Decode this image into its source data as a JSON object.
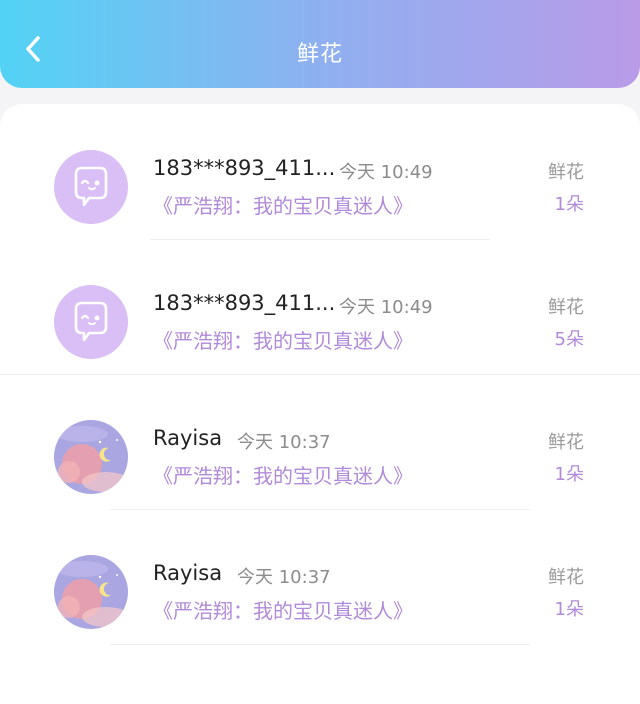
{
  "header": {
    "title": "鲜花",
    "back_icon": "chevron-left-icon",
    "gradient_start": "#52d3f5",
    "gradient_end": "#b99be8"
  },
  "records": [
    {
      "avatar": "chat-bubble-wink-avatar",
      "name": "183***893_411...",
      "time": "今天 10:49",
      "song": "《严浩翔：我的宝贝真迷人》",
      "gift_label": "鲜花",
      "count": "1朵"
    },
    {
      "avatar": "chat-bubble-wink-avatar",
      "name": "183***893_411...",
      "time": "今天 10:49",
      "song": "《严浩翔：我的宝贝真迷人》",
      "gift_label": "鲜花",
      "count": "5朵"
    },
    {
      "avatar": "moon-cloud-avatar",
      "name": "Rayisa",
      "time": "今天 10:37",
      "song": "《严浩翔：我的宝贝真迷人》",
      "gift_label": "鲜花",
      "count": "1朵"
    },
    {
      "avatar": "moon-cloud-avatar",
      "name": "Rayisa",
      "time": "今天 10:37",
      "song": "《严浩翔：我的宝贝真迷人》",
      "gift_label": "鲜花",
      "count": "1朵"
    }
  ],
  "colors": {
    "accent_purple": "#b18ad9",
    "avatar_purple": "#d9bff5"
  }
}
